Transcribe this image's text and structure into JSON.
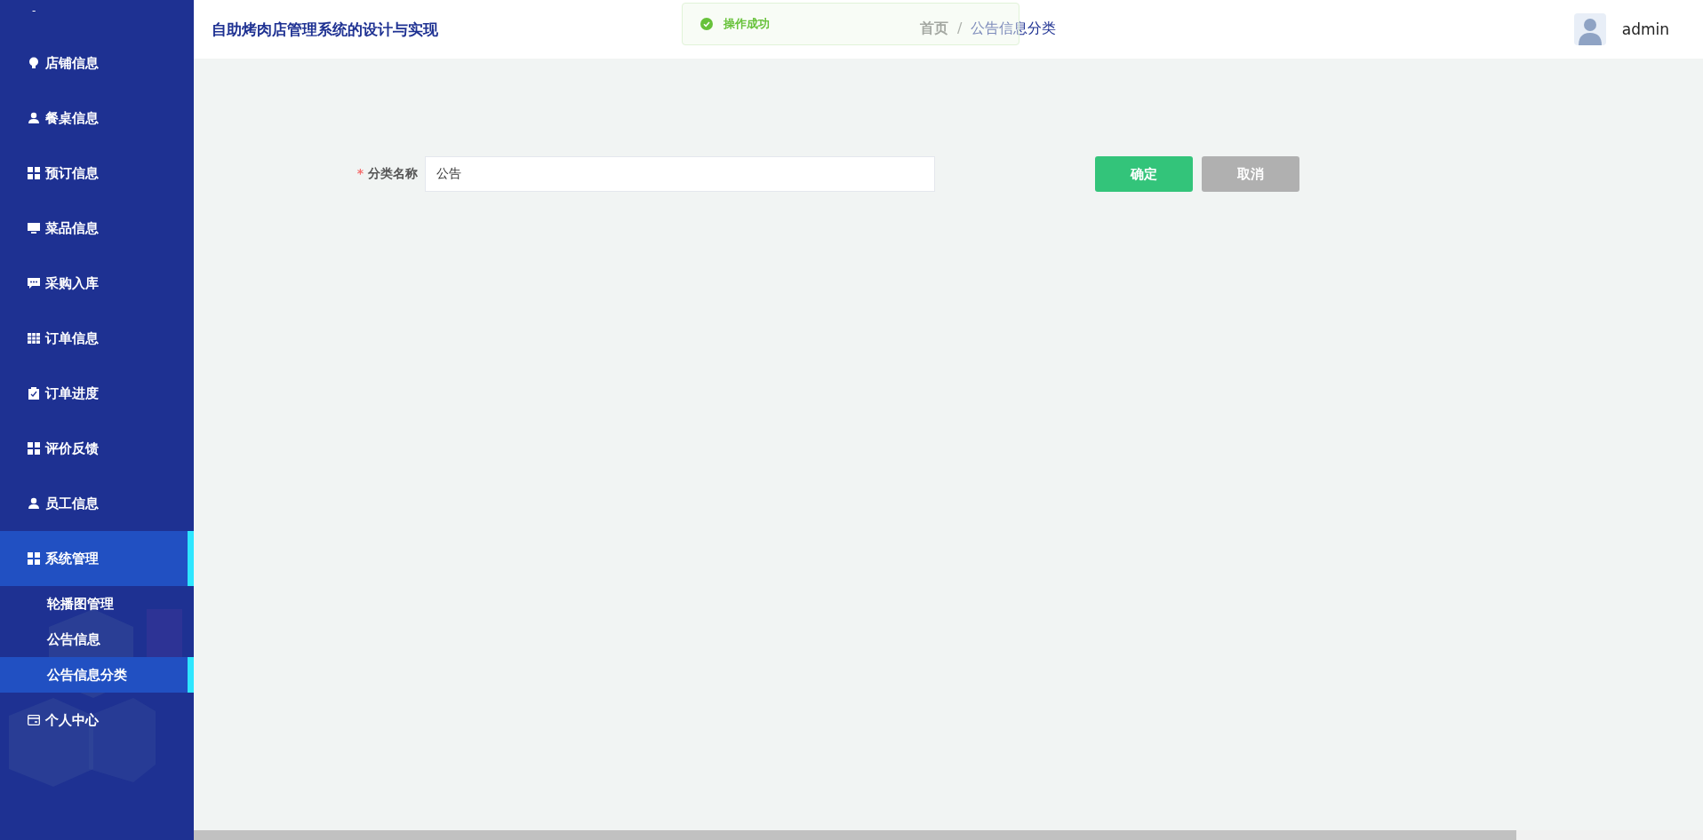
{
  "sidebar": {
    "top_mark": "-",
    "items": [
      {
        "label": "店铺信息",
        "selected": false
      },
      {
        "label": "餐桌信息",
        "selected": false
      },
      {
        "label": "预订信息",
        "selected": false
      },
      {
        "label": "菜品信息",
        "selected": false
      },
      {
        "label": "采购入库",
        "selected": false
      },
      {
        "label": "订单信息",
        "selected": false
      },
      {
        "label": "订单进度",
        "selected": false
      },
      {
        "label": "评价反馈",
        "selected": false
      },
      {
        "label": "员工信息",
        "selected": false
      },
      {
        "label": "系统管理",
        "selected": true,
        "children": [
          {
            "label": "轮播图管理",
            "selected": false
          },
          {
            "label": "公告信息",
            "selected": false
          },
          {
            "label": "公告信息分类",
            "selected": true
          }
        ]
      },
      {
        "label": "个人中心",
        "selected": false
      }
    ]
  },
  "header": {
    "title": "自助烤肉店管理系统的设计与实现",
    "breadcrumb": [
      "首页",
      "公告信息分类"
    ],
    "separator": "/",
    "user": "admin"
  },
  "toast": {
    "message": "操作成功"
  },
  "form": {
    "label": "分类名称",
    "required_mark": "*",
    "value": "公告"
  },
  "buttons": [
    {
      "label": "确定",
      "kind": "primary"
    },
    {
      "label": "取消",
      "kind": "cancel"
    }
  ]
}
